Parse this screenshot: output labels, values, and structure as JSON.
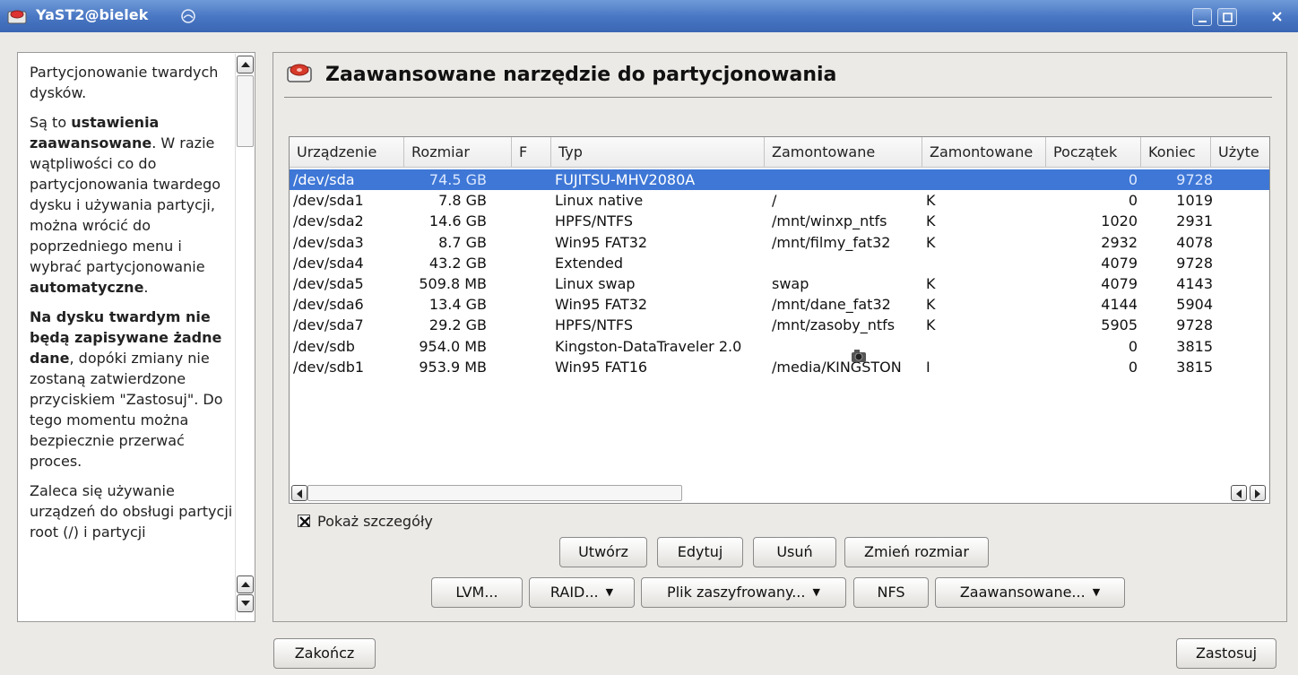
{
  "window": {
    "title": "YaST2@bielek",
    "controls": [
      "minimize-icon",
      "maximize-icon",
      "close-icon"
    ]
  },
  "help": {
    "paragraphs": [
      [
        {
          "t": "Partycjonowanie twardych dysków.",
          "b": false
        }
      ],
      [
        {
          "t": "Są to ",
          "b": false
        },
        {
          "t": "ustawienia zaawansowane",
          "b": true
        },
        {
          "t": ". W razie wątpliwości co do partycjonowania twardego dysku i używania partycji, można wrócić do poprzedniego menu i wybrać partycjonowanie ",
          "b": false
        },
        {
          "t": "automatyczne",
          "b": true
        },
        {
          "t": ".",
          "b": false
        }
      ],
      [
        {
          "t": "Na dysku twardym nie będą zapisywane żadne dane",
          "b": true
        },
        {
          "t": ", dopóki zmiany nie zostaną zatwierdzone przyciskiem \"Zastosuj\". Do tego momentu można bezpiecznie przerwać proces.",
          "b": false
        }
      ],
      [
        {
          "t": "Zaleca się używanie urządzeń do obsługi partycji root (/) i partycji",
          "b": false
        }
      ]
    ]
  },
  "main": {
    "title": "Zaawansowane narzędzie do partycjonowania",
    "columns": [
      "Urządzenie",
      "Rozmiar",
      "F",
      "Typ",
      "Zamontowane",
      "Zamontowane",
      "Początek",
      "Koniec",
      "Użyte"
    ],
    "rows": [
      [
        "/dev/sda",
        "74.5 GB",
        "",
        "FUJITSU-MHV2080A",
        "",
        "",
        "0",
        "9728"
      ],
      [
        "/dev/sda1",
        "7.8 GB",
        "",
        "Linux native",
        "/",
        "K",
        "0",
        "1019"
      ],
      [
        "/dev/sda2",
        "14.6 GB",
        "",
        "HPFS/NTFS",
        "/mnt/winxp_ntfs",
        "K",
        "1020",
        "2931"
      ],
      [
        "/dev/sda3",
        "8.7 GB",
        "",
        "Win95 FAT32",
        "/mnt/filmy_fat32",
        "K",
        "2932",
        "4078"
      ],
      [
        "/dev/sda4",
        "43.2 GB",
        "",
        "Extended",
        "",
        "",
        "4079",
        "9728"
      ],
      [
        "/dev/sda5",
        "509.8 MB",
        "",
        "Linux swap",
        "swap",
        "K",
        "4079",
        "4143"
      ],
      [
        "/dev/sda6",
        "13.4 GB",
        "",
        "Win95 FAT32",
        "/mnt/dane_fat32",
        "K",
        "4144",
        "5904"
      ],
      [
        "/dev/sda7",
        "29.2 GB",
        "",
        "HPFS/NTFS",
        "/mnt/zasoby_ntfs",
        "K",
        "5905",
        "9728"
      ],
      [
        "/dev/sdb",
        "954.0 MB",
        "",
        "Kingston-DataTraveler 2.0",
        "",
        "",
        "0",
        "3815"
      ],
      [
        "/dev/sdb1",
        "953.9 MB",
        "",
        "Win95 FAT16",
        "/media/KINGSTON",
        "I",
        "0",
        "3815"
      ]
    ],
    "selected_row": 0,
    "show_details_label": "Pokaż szczegóły",
    "show_details_checked": true,
    "buttons_row1": [
      "Utwórz",
      "Edytuj",
      "Usuń",
      "Zmień rozmiar"
    ],
    "buttons_row2": [
      "LVM...",
      "RAID...",
      "Plik zaszyfrowany...",
      "NFS",
      "Zaawansowane..."
    ],
    "dropdown_buttons": [
      "RAID...",
      "Plik zaszyfrowany...",
      "Zaawansowane..."
    ]
  },
  "footer": {
    "quit_label": "Zakończ",
    "apply_label": "Zastosuj"
  },
  "colors": {
    "titlebar": "#4a78c4",
    "selection": "#3e77d6"
  }
}
